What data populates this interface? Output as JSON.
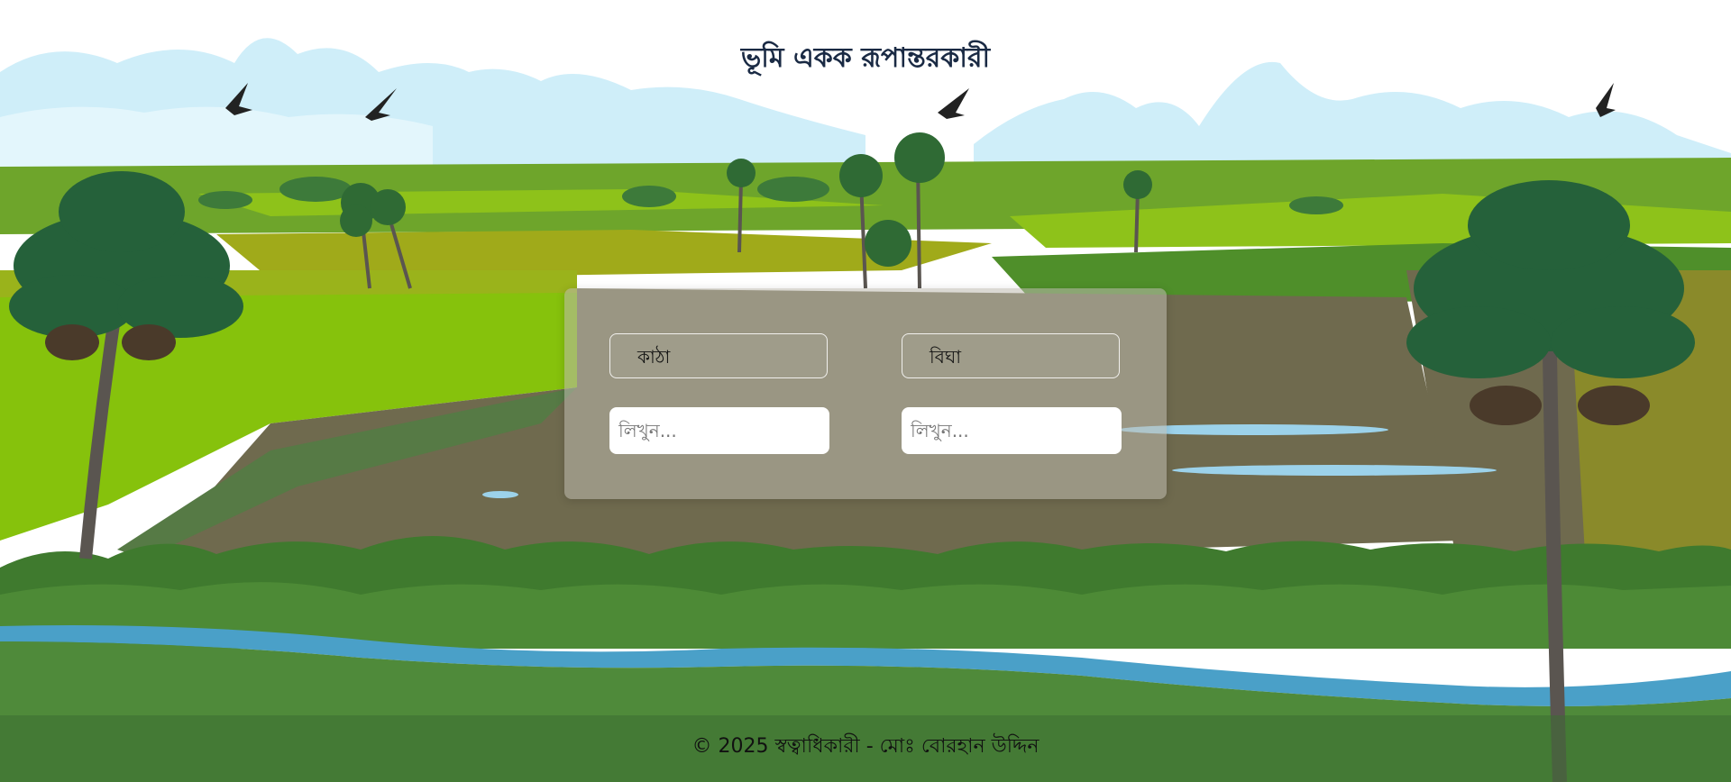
{
  "header": {
    "title": "ভূমি একক রূপান্তরকারী"
  },
  "converter": {
    "from_unit": "কাঠা",
    "to_unit": "বিঘা",
    "from_placeholder": "লিখুন...",
    "to_placeholder": "লিখুন...",
    "from_value": "",
    "to_value": ""
  },
  "footer": {
    "copyright": "© 2025 স্বত্বাধিকারী - মোঃ বোরহান উদ্দিন"
  },
  "colors": {
    "title": "#1a2a44",
    "sky": "#ffffff",
    "field_green": "#8ec21a",
    "mud": "#6f6a4e",
    "river": "#4aa0c8",
    "card_overlay": "#beb9af"
  }
}
